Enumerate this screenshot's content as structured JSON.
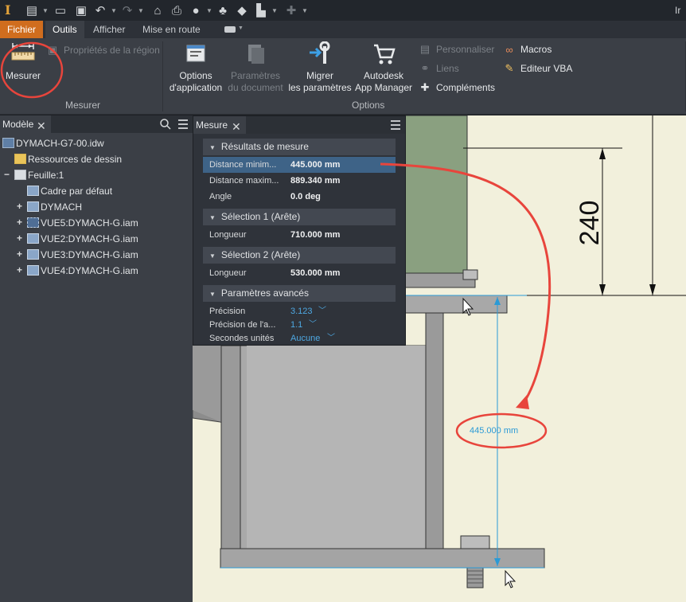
{
  "titlebar": {
    "title_fragment": "Ir"
  },
  "ribbon_tabs": [
    {
      "label": "Fichier"
    },
    {
      "label": "Outils"
    },
    {
      "label": "Afficher"
    },
    {
      "label": "Mise en route"
    }
  ],
  "ribbon": {
    "measure_panel": {
      "title": "Mesurer",
      "measure_button": "Mesurer",
      "region_properties": "Propriétés de la région"
    },
    "options_panel": {
      "title": "Options",
      "app_options_line1": "Options",
      "app_options_line2": "d'application",
      "doc_params_line1": "Paramètres",
      "doc_params_line2": "du document",
      "migrate_line1": "Migrer",
      "migrate_line2": "les paramètres",
      "autodesk_line1": "Autodesk",
      "autodesk_line2": "App Manager",
      "customize": "Personnaliser",
      "links": "Liens",
      "addins": "Compléments",
      "macros": "Macros",
      "vba_editor": "Editeur VBA"
    }
  },
  "browser": {
    "tab_label": "Modèle",
    "tree": [
      {
        "label": "DYMACH-G7-00.idw",
        "icon": "drawing-icon"
      },
      {
        "label": "Ressources de dessin",
        "icon": "folder-icon"
      },
      {
        "label": "Feuille:1",
        "icon": "sheet-icon"
      },
      {
        "label": "Cadre par défaut",
        "icon": "frame-icon"
      },
      {
        "label": "DYMACH",
        "icon": "titleblock-icon"
      },
      {
        "label": "VUE5:DYMACH-G.iam",
        "icon": "view-icon"
      },
      {
        "label": "VUE2:DYMACH-G.iam",
        "icon": "view-icon"
      },
      {
        "label": "VUE3:DYMACH-G.iam",
        "icon": "view-icon"
      },
      {
        "label": "VUE4:DYMACH-G.iam",
        "icon": "view-icon"
      }
    ]
  },
  "measure": {
    "tab_label": "Mesure",
    "results": {
      "header": "Résultats de mesure",
      "min_distance_label": "Distance minim...",
      "min_distance_value": "445.000 mm",
      "max_distance_label": "Distance maxim...",
      "max_distance_value": "889.340 mm",
      "angle_label": "Angle",
      "angle_value": "0.0 deg"
    },
    "selection1": {
      "header": "Sélection 1 (Arête)",
      "length_label": "Longueur",
      "length_value": "710.000 mm"
    },
    "selection2": {
      "header": "Sélection 2 (Arête)",
      "length_label": "Longueur",
      "length_value": "530.000 mm"
    },
    "advanced": {
      "header": "Paramètres avancés",
      "precision_label": "Précision",
      "precision_value": "3.123",
      "angle_precision_label": "Précision de l'a...",
      "angle_precision_value": "1.1",
      "secondary_units_label": "Secondes unités",
      "secondary_units_value": "Aucune"
    }
  },
  "canvas": {
    "dimension_text": "240",
    "measure_callout": "445.000 mm"
  },
  "colors": {
    "file_tab": "#d06d1e",
    "highlight_row": "#3e6387",
    "annotation_red": "#e8453c",
    "measure_blue": "#2b9ad6",
    "canvas_bg": "#f2f0dc"
  }
}
